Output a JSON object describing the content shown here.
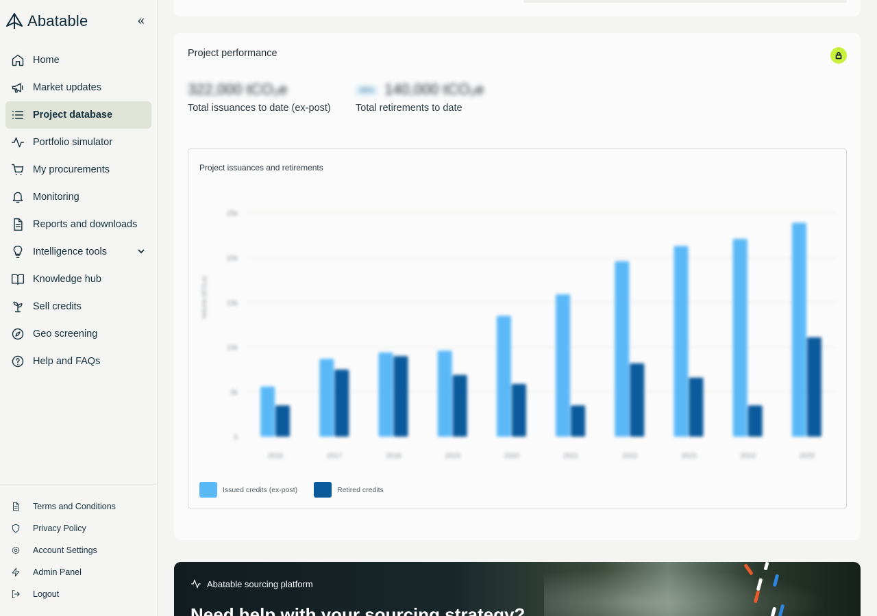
{
  "brand": {
    "name": "Abatable"
  },
  "sidebar": {
    "items": [
      {
        "label": "Home",
        "icon": "home-icon"
      },
      {
        "label": "Market updates",
        "icon": "megaphone-icon"
      },
      {
        "label": "Project database",
        "icon": "list-icon",
        "active": true
      },
      {
        "label": "Portfolio simulator",
        "icon": "activity-icon"
      },
      {
        "label": "My procurements",
        "icon": "cart-icon"
      },
      {
        "label": "Monitoring",
        "icon": "bell-icon"
      },
      {
        "label": "Reports and downloads",
        "icon": "document-icon"
      },
      {
        "label": "Intelligence tools",
        "icon": "lightbulb-icon",
        "expandable": true
      },
      {
        "label": "Knowledge hub",
        "icon": "book-icon"
      },
      {
        "label": "Sell credits",
        "icon": "sprout-icon"
      },
      {
        "label": "Geo screening",
        "icon": "compass-icon"
      },
      {
        "label": "Help and FAQs",
        "icon": "help-icon"
      }
    ],
    "footer": [
      {
        "label": "Terms and Conditions",
        "icon": "document-icon"
      },
      {
        "label": "Privacy Policy",
        "icon": "shield-icon"
      },
      {
        "label": "Account Settings",
        "icon": "gear-icon"
      },
      {
        "label": "Admin Panel",
        "icon": "bolt-icon"
      },
      {
        "label": "Logout",
        "icon": "logout-icon"
      }
    ]
  },
  "performance": {
    "title": "Project performance",
    "issuances_value": "322,000 tCO₂e",
    "issuances_label": "Total issuances to date (ex-post)",
    "retirements_badge": "45%",
    "retirements_value": "140,000 tCO₂e",
    "retirements_label": "Total retirements to date"
  },
  "chart_data": {
    "type": "bar",
    "title": "Project issuances and retirements",
    "ylabel": "Volume (tCO₂e)",
    "ylim": [
      0,
      25000
    ],
    "yticks": [
      "0",
      "5k",
      "10k",
      "15k",
      "20k",
      "25k"
    ],
    "categories": [
      "2016",
      "2017",
      "2018",
      "2019",
      "2020",
      "2021",
      "2022",
      "2023",
      "2024",
      "2025"
    ],
    "series": [
      {
        "name": "Issued credits (ex-post)",
        "color": "#5ab8f7",
        "values": [
          5600,
          8700,
          9400,
          9600,
          13500,
          15900,
          19600,
          21300,
          22100,
          23900
        ]
      },
      {
        "name": "Retired credits",
        "color": "#0a5a9c",
        "values": [
          3500,
          7500,
          9000,
          6900,
          5900,
          3500,
          8200,
          6600,
          3500,
          11100
        ]
      }
    ]
  },
  "banner": {
    "tag": "Abatable sourcing platform",
    "heading": "Need help with your sourcing strategy?"
  }
}
